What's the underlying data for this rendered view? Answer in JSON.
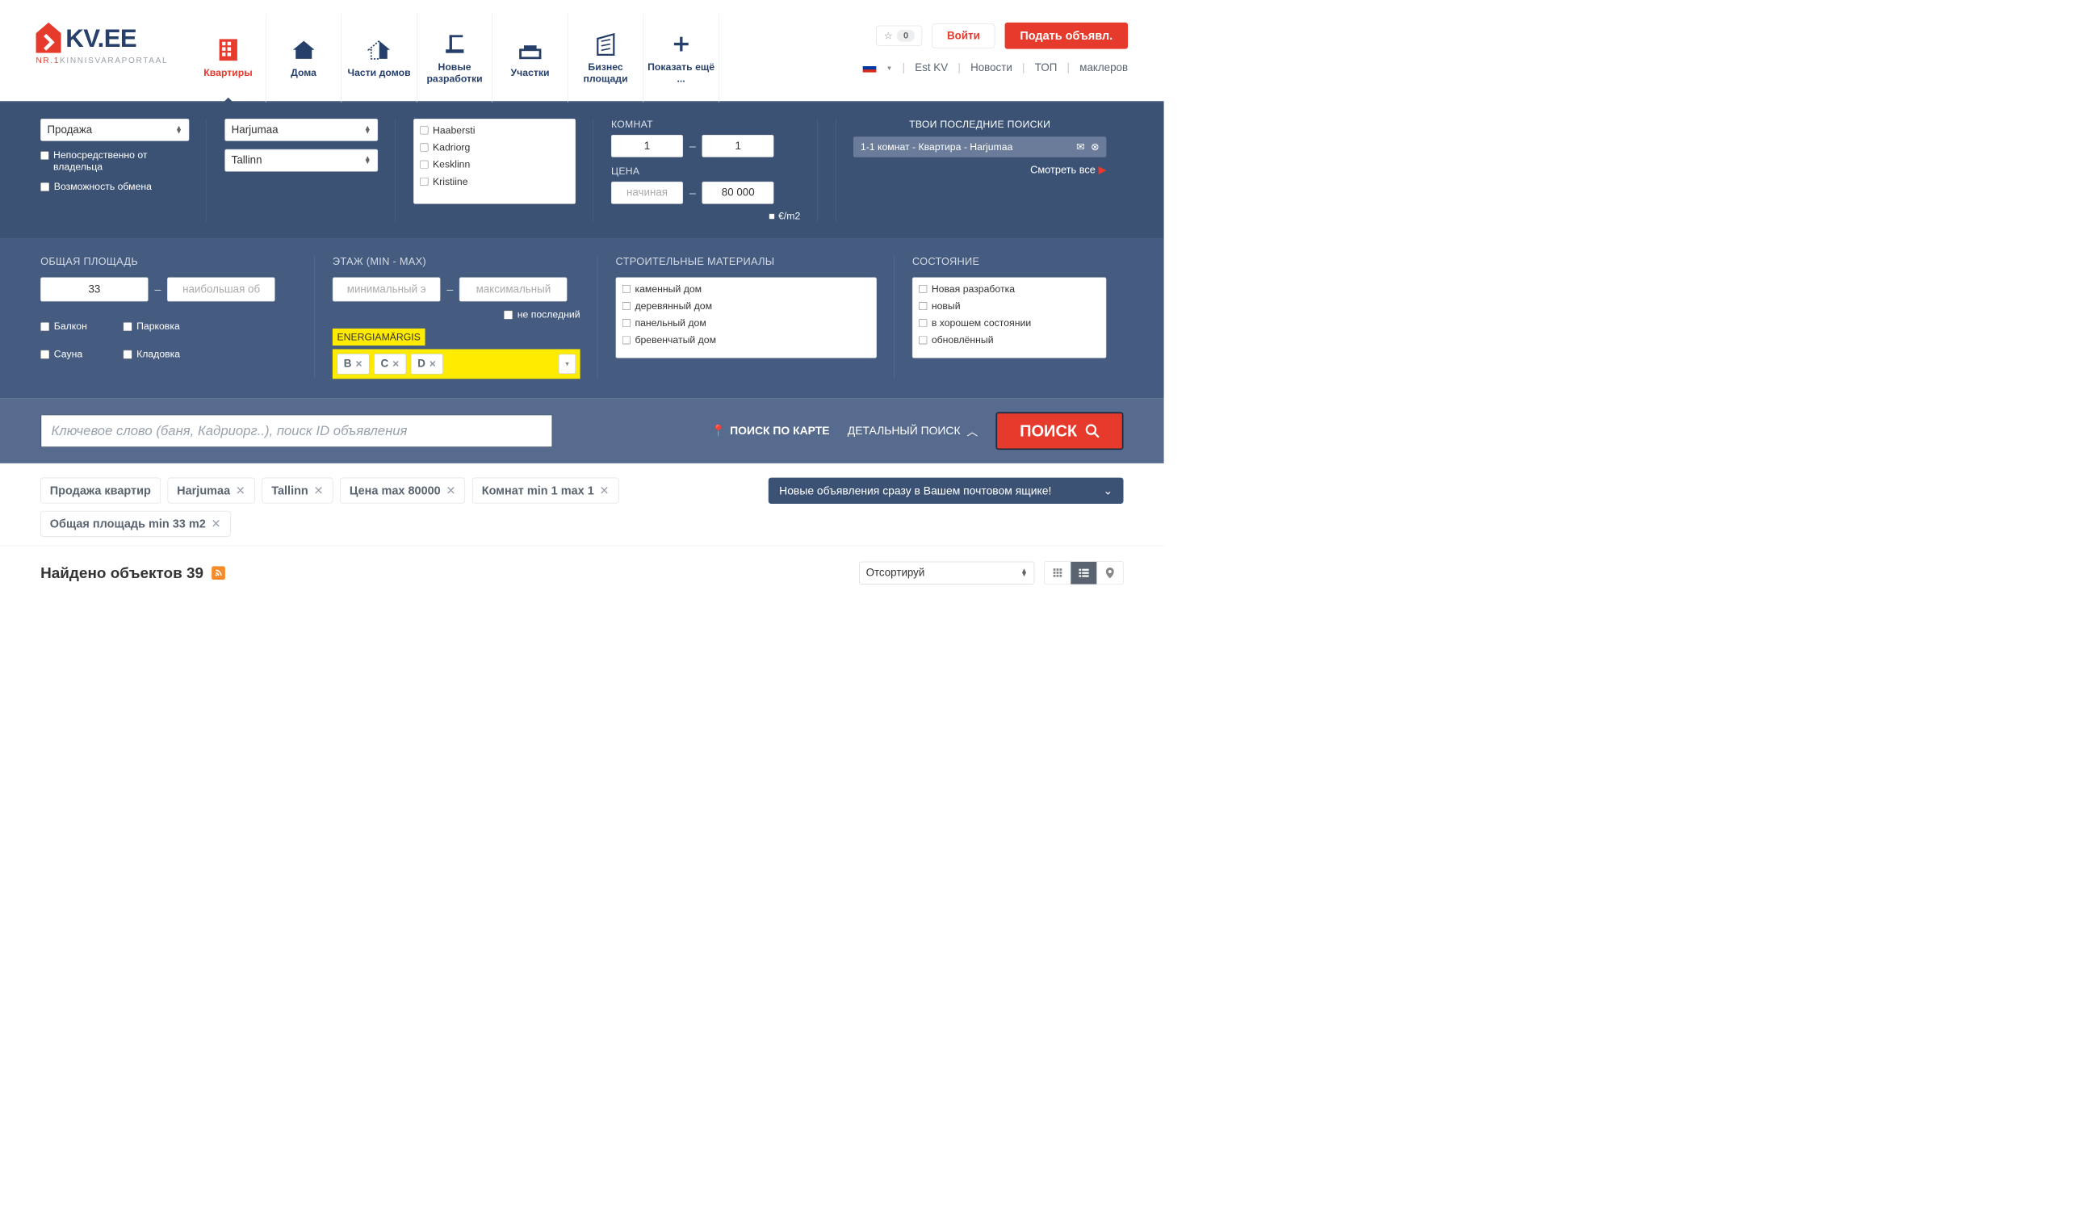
{
  "logo": {
    "text": "KV.EE",
    "sub_left": "NR.1",
    "sub_right": "KINNISVARAPORTAAL"
  },
  "nav": {
    "items": [
      {
        "label": "Квартиры"
      },
      {
        "label": "Дома"
      },
      {
        "label": "Части домов"
      },
      {
        "label": "Новые разработки"
      },
      {
        "label": "Участки"
      },
      {
        "label": "Бизнес площади"
      },
      {
        "label": "Показать ещё ..."
      }
    ]
  },
  "header": {
    "fav_count": "0",
    "login": "Войти",
    "post": "Подать объявл.",
    "links": [
      "Est KV",
      "Новости",
      "ТОП",
      "маклеров"
    ]
  },
  "filter": {
    "deal": "Продажа",
    "owner_cb": "Непосредственно от владельца",
    "exchange_cb": "Возможность обмена",
    "region": "Harjumaa",
    "city": "Tallinn",
    "districts": [
      "Haabersti",
      "Kadriorg",
      "Kesklinn",
      "Kristiine"
    ],
    "rooms_lbl": "КОМНАТ",
    "rooms_min": "1",
    "rooms_max": "1",
    "price_lbl": "ЦЕНА",
    "price_min_ph": "начиная",
    "price_max": "80 000",
    "eur_m2": "€/m2",
    "recent_h": "ТВОИ ПОСЛЕДНИЕ ПОИСКИ",
    "recent_item": "1-1 комнат - Квартира - Harjumaa",
    "see_all": "Смотреть все"
  },
  "filter2": {
    "area_h": "ОБЩАЯ ПЛОЩАДЬ",
    "area_min": "33",
    "area_max_ph": "наибольшая об",
    "feat": {
      "balcony": "Балкон",
      "parking": "Парковка",
      "sauna": "Сауна",
      "storage": "Кладовка"
    },
    "floor_h": "ЭТАЖ (MIN - MAX)",
    "floor_min_ph": "минимальный э",
    "floor_max_ph": "максимальный",
    "notlast": "не последний",
    "energ_h": "ENERGIAMÄRGIS",
    "energ": [
      "B",
      "C",
      "D"
    ],
    "mat_h": "СТРОИТЕЛЬНЫЕ МАТЕРИАЛЫ",
    "mats": [
      "каменный дом",
      "деревянный дом",
      "панельный дом",
      "бревенчатый дом"
    ],
    "cond_h": "СОСТОЯНИЕ",
    "conds": [
      "Новая разработка",
      "новый",
      "в хорошем состоянии",
      "обновлённый"
    ]
  },
  "searchrow": {
    "kw_ph": "Ключевое слово (баня, Кадриорг..), поиск ID объявления",
    "map": "ПОИСК ПО КАРТЕ",
    "detail": "ДЕТАЛЬНЫЙ ПОИСК",
    "search": "ПОИСК"
  },
  "chips": {
    "items": [
      {
        "t": "Продажа квартир",
        "x": false
      },
      {
        "t": "Harjumaa",
        "x": true
      },
      {
        "t": "Tallinn",
        "x": true
      },
      {
        "t": "Цена max 80000",
        "x": true
      },
      {
        "t": "Комнат min 1 max 1",
        "x": true
      },
      {
        "t": "Общая площадь min 33 m2",
        "x": true
      }
    ],
    "subscribe": "Новые объявления сразу в Вашем почтовом ящике!"
  },
  "results": {
    "found_pre": "Найдено объектов ",
    "found_n": "39",
    "sort": "Отсортируй"
  }
}
